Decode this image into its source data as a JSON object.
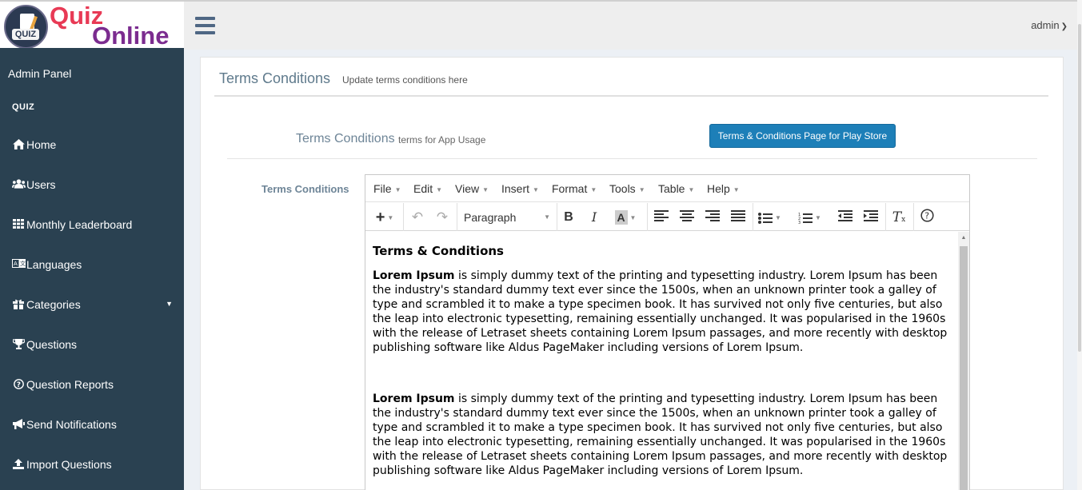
{
  "logo": {
    "text_line1": "Quiz",
    "text_line2": "Online",
    "badge": "QUIZ"
  },
  "header": {
    "user": "admin"
  },
  "sidebar": {
    "title": "Admin Panel",
    "section": "QUIZ",
    "items": [
      {
        "label": "Home",
        "icon": "home-icon"
      },
      {
        "label": "Users",
        "icon": "users-icon"
      },
      {
        "label": "Monthly Leaderboard",
        "icon": "table-icon"
      },
      {
        "label": "Languages",
        "icon": "language-icon"
      },
      {
        "label": "Categories",
        "icon": "gift-icon"
      },
      {
        "label": "Questions",
        "icon": "trophy-icon"
      },
      {
        "label": "Question Reports",
        "icon": "question-circle-icon"
      },
      {
        "label": "Send Notifications",
        "icon": "bullhorn-icon"
      },
      {
        "label": "Import Questions",
        "icon": "upload-icon"
      }
    ]
  },
  "page": {
    "title": "Terms Conditions",
    "subtitle": "Update terms conditions here",
    "section_title": "Terms Conditions",
    "section_subtitle": "terms for App Usage",
    "store_button": "Terms & Conditions Page for Play Store",
    "field_label": "Terms Conditions"
  },
  "editor": {
    "menu": [
      "File",
      "Edit",
      "View",
      "Insert",
      "Format",
      "Tools",
      "Table",
      "Help"
    ],
    "block_format": "Paragraph",
    "heading": "Terms & Conditions",
    "paragraphs": [
      {
        "bold": "Lorem Ipsum",
        "text": " is simply dummy text of the printing and typesetting industry. Lorem Ipsum has been the industry's standard dummy text ever since the 1500s, when an unknown printer took a galley of type and scrambled it to make a type specimen book. It has survived not only five centuries, but also the leap into electronic typesetting, remaining essentially unchanged. It was popularised in the 1960s with the release of Letraset sheets containing Lorem Ipsum passages, and more recently with desktop publishing software like Aldus PageMaker including versions of Lorem Ipsum."
      },
      {
        "bold": "Lorem Ipsum",
        "text": " is simply dummy text of the printing and typesetting industry. Lorem Ipsum has been the industry's standard dummy text ever since the 1500s, when an unknown printer took a galley of type and scrambled it to make a type specimen book. It has survived not only five centuries, but also the leap into electronic typesetting, remaining essentially unchanged. It was popularised in the 1960s with the release of Letraset sheets containing Lorem Ipsum passages, and more recently with desktop publishing software like Aldus PageMaker including versions of Lorem Ipsum."
      }
    ]
  },
  "colors": {
    "sidebar_bg": "#2a4151",
    "accent_button": "#1d7fb8",
    "logo_red": "#e83a55",
    "logo_purple": "#7b2c8f"
  }
}
